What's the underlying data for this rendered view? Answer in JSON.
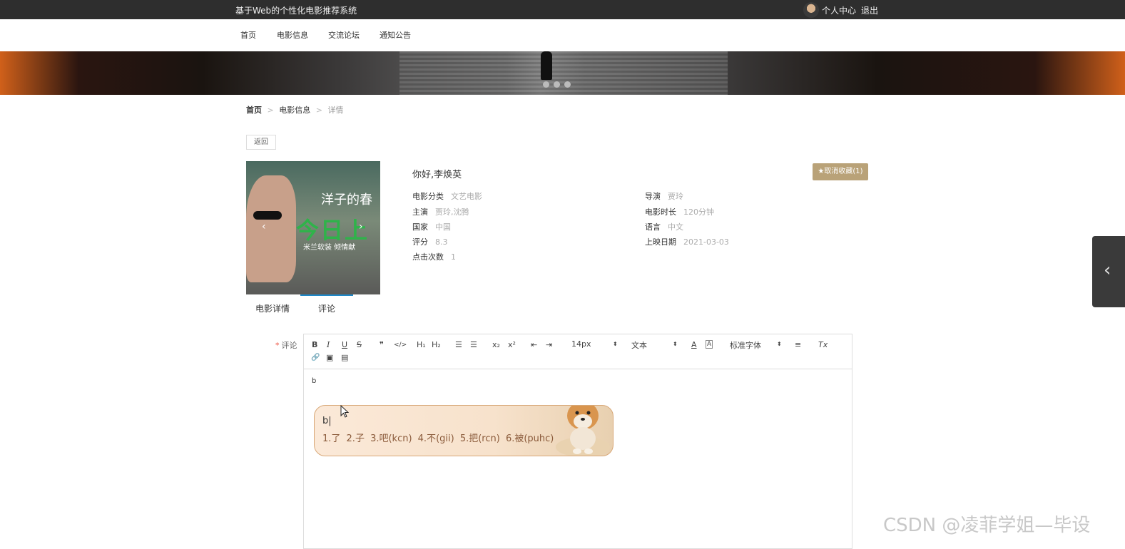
{
  "header": {
    "site_title": "基于Web的个性化电影推荐系统",
    "user_center": "个人中心",
    "logout": "退出"
  },
  "nav": {
    "items": [
      "首页",
      "电影信息",
      "交流论坛",
      "通知公告"
    ]
  },
  "breadcrumb": {
    "home": "首页",
    "sep": ">",
    "section": "电影信息",
    "current": "详情"
  },
  "back_label": "返回",
  "poster": {
    "top_text": "洋子的春",
    "big_text": "今日上",
    "sub_text": "米兰软装 倾情献",
    "prev": "‹",
    "next": "›"
  },
  "movie": {
    "welcome": "你好,李焕英",
    "favorite_label": "★取消收藏(1)",
    "fields": {
      "category": {
        "k": "电影分类",
        "v": "文艺电影"
      },
      "director": {
        "k": "导演",
        "v": "贾玲"
      },
      "actors": {
        "k": "主演",
        "v": "贾玲,沈腾"
      },
      "duration": {
        "k": "电影时长",
        "v": "120分钟"
      },
      "country": {
        "k": "国家",
        "v": "中国"
      },
      "language": {
        "k": "语言",
        "v": "中文"
      },
      "rating": {
        "k": "评分",
        "v": "8.3"
      },
      "release": {
        "k": "上映日期",
        "v": "2021-03-03"
      },
      "clicks": {
        "k": "点击次数",
        "v": "1"
      }
    }
  },
  "tabs": {
    "detail": "电影详情",
    "comment": "评论",
    "active": "评论"
  },
  "form": {
    "required_mark": "*",
    "comment_label": "评论"
  },
  "editor": {
    "toolbar": {
      "bold": "B",
      "italic": "I",
      "underline": "U",
      "strike": "S",
      "quote": "❞",
      "code": "</>",
      "h1": "H₁",
      "h2": "H₂",
      "ordered_list": "☰",
      "bullet_list": "☰",
      "subscript": "x₂",
      "superscript": "x²",
      "outdent": "⇤",
      "indent": "⇥",
      "size": "14px",
      "header": "文本",
      "font": "标准字体",
      "align": "≡",
      "clean": "Tx",
      "link": "🔗",
      "image": "▣",
      "video": "▤"
    },
    "content": "b"
  },
  "ime": {
    "input": "b|",
    "candidates": "1.了 2.子 3.吧(kcn) 4.不(gii) 5.把(rcn) 6.被(puhc)"
  },
  "watermark": "CSDN @凌菲学姐—毕设",
  "colors": {
    "topbar": "#2e2e2e",
    "favorite": "#b9a278",
    "tab_active": "#1e88c8"
  }
}
